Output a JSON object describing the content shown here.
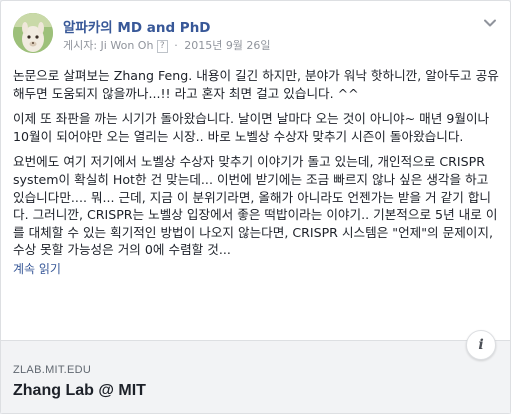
{
  "post": {
    "page_name": "알파카의 MD and PhD",
    "meta_prefix": "게시자: Ji Won Oh",
    "meta_q": "?",
    "meta_date": "2015년 9월 26일",
    "meta_sep": "·",
    "paragraphs": [
      "논문으로 살펴보는 Zhang Feng. 내용이 길긴 하지만, 분야가 워낙 핫하니깐, 알아두고 공유해두면 도움되지 않을까나...!! 라고 혼자 최면 걸고 있습니다. ^^",
      "이제 또 좌판을 까는 시기가 돌아왔습니다. 날이면 날마다 오는 것이 아니야~ 매년 9월이나 10월이 되어야만 오는 열리는 시장.. 바로 노벨상 수상자 맞추기 시즌이 돌아왔습니다.",
      "요번에도 여기 저기에서 노벨상 수상자 맞추기 이야기가 돌고 있는데, 개인적으로 CRISPR system이 확실히 Hot한 건 맞는데... 이번에 받기에는 조금 빠르지 않나 싶은 생각을 하고 있습니다만.... 뭐... 근데, 지금 이 분위기라면, 올해가 아니라도 언젠가는 받을 거 같기 합니다. 그러니깐, CRISPR는 노벨상 입장에서 좋은 떡밥이라는 이야기.. 기본적으로 5년 내로 이를 대체할 수 있는 획기적인 방법이 나오지 않는다면, CRISPR 시스템은 \"언제\"의 문제이지, 수상 못할 가능성은 거의 0에 수렴할 것..."
    ],
    "see_more": "계속 읽기"
  },
  "link_preview": {
    "domain": "ZLAB.MIT.EDU",
    "title": "Zhang Lab @ MIT"
  },
  "icons": {
    "avatar": "alpaca-avatar",
    "options": "chevron-down-icon",
    "info": "info-icon"
  }
}
